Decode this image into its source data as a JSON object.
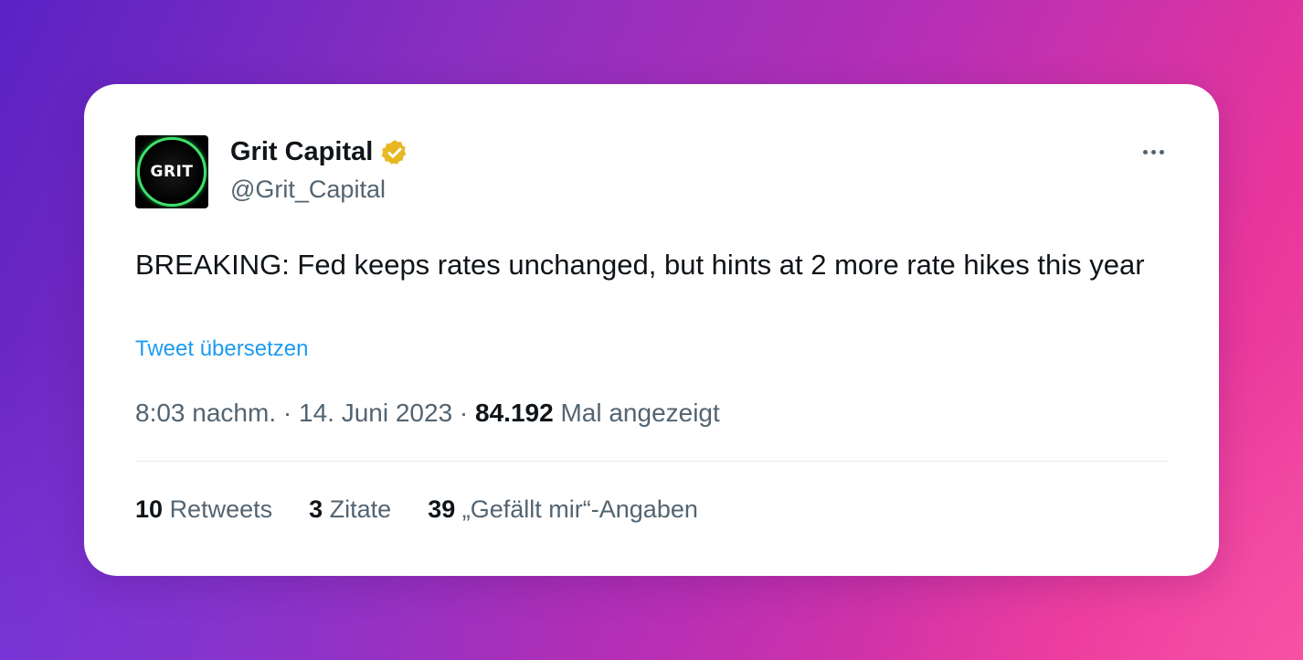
{
  "colors": {
    "text_primary": "#0f1419",
    "text_secondary": "#536471",
    "link": "#1d9bf0",
    "verified_badge": "#e8b823",
    "avatar_ring": "#3ee06a"
  },
  "tweet": {
    "author": {
      "avatar_text": "GRIT",
      "display_name": "Grit Capital",
      "handle": "@Grit_Capital",
      "verified_icon": "verified-badge-icon"
    },
    "more_icon": "more-options-icon",
    "text": "BREAKING: Fed keeps rates unchanged, but hints at 2 more rate hikes this year",
    "translate_label": "Tweet übersetzen",
    "time": "8:03 nachm.",
    "separator": " · ",
    "date": "14. Juni 2023",
    "views_count": "84.192",
    "views_label": "Mal angezeigt",
    "stats": {
      "retweets": {
        "count": "10",
        "label": "Retweets"
      },
      "quotes": {
        "count": "3",
        "label": "Zitate"
      },
      "likes": {
        "count": "39",
        "label": "„Gefällt mir“-Angaben"
      }
    }
  }
}
